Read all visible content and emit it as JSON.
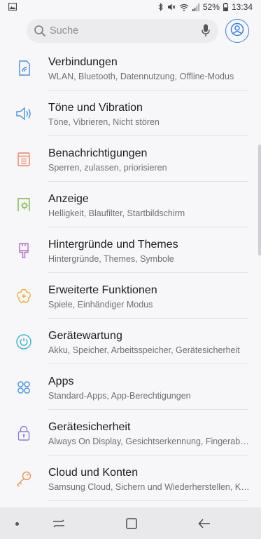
{
  "status_bar": {
    "battery_percent": "52%",
    "time": "13:34",
    "icons": [
      "gallery-notification-icon",
      "bluetooth-icon",
      "mute-icon",
      "wifi-icon",
      "signal-icon",
      "battery-icon"
    ]
  },
  "search": {
    "placeholder": "Suche",
    "icons": [
      "search-icon",
      "mic-icon",
      "profile-icon"
    ]
  },
  "settings": [
    {
      "title": "Verbindungen",
      "subtitle": "WLAN, Bluetooth, Datennutzung, Offline-Modus",
      "icon": "connections-icon",
      "color": "#4a90d9"
    },
    {
      "title": "Töne und Vibration",
      "subtitle": "Töne, Vibrieren, Nicht stören",
      "icon": "sound-icon",
      "color": "#4a90d9"
    },
    {
      "title": "Benachrichtigungen",
      "subtitle": "Sperren, zulassen, priorisieren",
      "icon": "notifications-icon",
      "color": "#e8826b"
    },
    {
      "title": "Anzeige",
      "subtitle": "Helligkeit, Blaufilter, Startbildschirm",
      "icon": "display-icon",
      "color": "#7fb54a"
    },
    {
      "title": "Hintergründe und Themes",
      "subtitle": "Hintergründe, Themes, Symbole",
      "icon": "themes-icon",
      "color": "#b66cc9"
    },
    {
      "title": "Erweiterte Funktionen",
      "subtitle": "Spiele, Einhändiger Modus",
      "icon": "advanced-features-icon",
      "color": "#e9b04a"
    },
    {
      "title": "Gerätewartung",
      "subtitle": "Akku, Speicher, Arbeitsspeicher, Gerätesicherheit",
      "icon": "device-maintenance-icon",
      "color": "#3fb1c9"
    },
    {
      "title": "Apps",
      "subtitle": "Standard-Apps, App-Berechtigungen",
      "icon": "apps-icon",
      "color": "#4a90d9"
    },
    {
      "title": "Gerätesicherheit",
      "subtitle": "Always On Display, Gesichtserkennung, Fingerabdrücke",
      "icon": "lock-icon",
      "color": "#8a7fd1"
    },
    {
      "title": "Cloud und Konten",
      "subtitle": "Samsung Cloud, Sichern und Wiederherstellen, Konten",
      "icon": "key-icon",
      "color": "#e8975a"
    }
  ],
  "navigation_bar": {
    "icons": [
      "nav-dot-icon",
      "recent-apps-icon",
      "home-icon",
      "back-icon"
    ]
  }
}
